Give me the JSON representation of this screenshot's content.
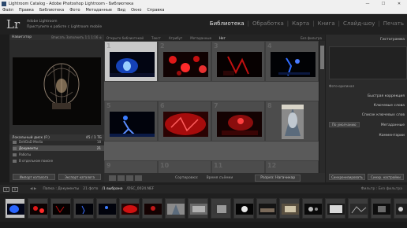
{
  "window": {
    "title": "Lightroom Catalog - Adobe Photoshop Lightroom - Библиотека",
    "controls": [
      "—",
      "☐",
      "✕"
    ]
  },
  "menu": [
    "Файл",
    "Правка",
    "Библиотека",
    "Фото",
    "Метаданные",
    "Вид",
    "Окно",
    "Справка"
  ],
  "identity": {
    "logo": "Lr",
    "line1": "Adobe Lightroom",
    "line2": "Приступите к работе с Lightroom mobile"
  },
  "modules": [
    "Библиотека",
    "Обработка",
    "Карта",
    "Книга",
    "Слайд-шоу",
    "Печать"
  ],
  "modules_sep": "|",
  "navigator": {
    "title": "Навигатор",
    "options": "Вписать   Заполнить   1:1   1:16 ≑"
  },
  "catalog": {
    "title": "Локальный диск (F:)",
    "count": "45 / 1 ТБ",
    "folders": [
      {
        "label": "DeVDaD Media",
        "count": "18"
      },
      {
        "label": "Документы",
        "count": "21"
      },
      {
        "label": "Работы",
        "count": ""
      },
      {
        "label": "В отдельном поиске",
        "count": ""
      }
    ]
  },
  "left_buttons": [
    "Импорт каталога",
    "Экспорт каталога"
  ],
  "filter_bar": {
    "title": "Открыто библиотекой",
    "items": [
      "Текст",
      "Атрибут",
      "Метаданные",
      "Нет"
    ],
    "active_index": 3,
    "right": "Без фильтра"
  },
  "grid_cells": [
    {
      "num": "1",
      "selected": true
    },
    {
      "num": "2",
      "selected": false
    },
    {
      "num": "3",
      "selected": false
    },
    {
      "num": "4",
      "selected": false
    },
    {
      "num": "5",
      "selected": false
    },
    {
      "num": "6",
      "selected": false
    },
    {
      "num": "7",
      "selected": false
    },
    {
      "num": "8",
      "selected": false
    },
    {
      "num": "9",
      "selected": false
    },
    {
      "num": "10",
      "selected": false
    },
    {
      "num": "11",
      "selected": false
    },
    {
      "num": "12",
      "selected": false
    }
  ],
  "toolbar": {
    "sort_label": "Сортировка:",
    "sort_value": "Время съёмки",
    "dropdown": "Разрез: Нагачикар"
  },
  "right_panel": {
    "histogram_title": "Гистограмма",
    "original_photo": "Фото-оригинал",
    "quick_develop": "Быстрая коррекция",
    "keywording": "Ключевые слова",
    "keyword_list": "Список ключевых слов",
    "default_label": "По умолчанию",
    "metadata": "Метаданные",
    "comments": "Комментарии"
  },
  "right_buttons": [
    "Синхронизировать",
    "Синхр. настройки"
  ],
  "filmstrip_bar": {
    "monitor1": "1",
    "monitor2": "2",
    "path": "Папка : Документы",
    "count": "21 фото",
    "selected": "/1 выбрано",
    "file": "/DSC_0024.NEF",
    "filter": "Фильтр : Без фильтра"
  }
}
